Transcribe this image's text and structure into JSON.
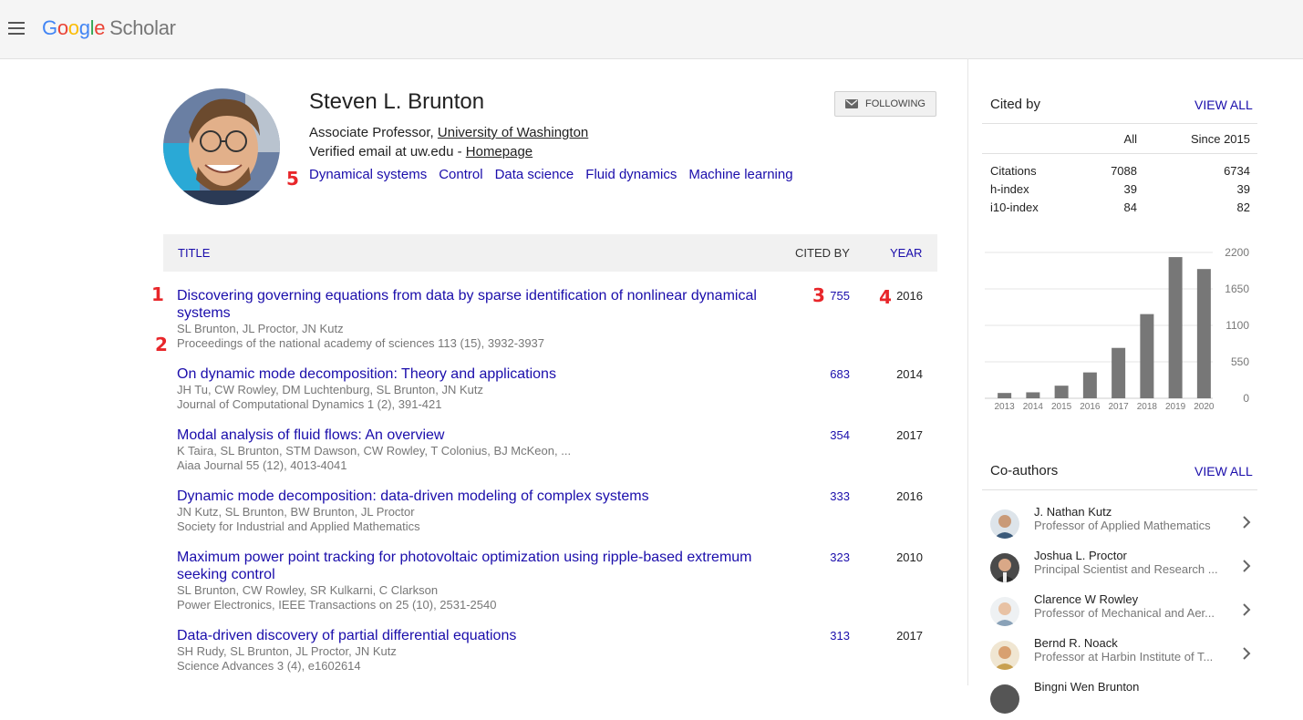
{
  "header": {
    "logo": {
      "google": [
        "G",
        "o",
        "o",
        "g",
        "l",
        "e"
      ],
      "scholar": "Scholar"
    }
  },
  "profile": {
    "name": "Steven L. Brunton",
    "title_prefix": "Associate Professor, ",
    "affiliation": "University of Washington",
    "email_prefix": "Verified email at uw.edu - ",
    "homepage": "Homepage",
    "interests": [
      "Dynamical systems",
      "Control",
      "Data science",
      "Fluid dynamics",
      "Machine learning"
    ],
    "follow_label": "FOLLOWING"
  },
  "annotations": [
    "1",
    "2",
    "3",
    "4",
    "5"
  ],
  "table": {
    "headers": {
      "title": "TITLE",
      "cited_by": "CITED BY",
      "year": "YEAR"
    },
    "rows": [
      {
        "title": "Discovering governing equations from data by sparse identification of nonlinear dynamical systems",
        "authors": "SL Brunton, JL Proctor, JN Kutz",
        "venue": "Proceedings of the national academy of sciences 113 (15), 3932-3937",
        "cited": "755",
        "year": "2016"
      },
      {
        "title": "On dynamic mode decomposition: Theory and applications",
        "authors": "JH Tu, CW Rowley, DM Luchtenburg, SL Brunton, JN Kutz",
        "venue": "Journal of Computational Dynamics 1 (2), 391-421",
        "cited": "683",
        "year": "2014"
      },
      {
        "title": "Modal analysis of fluid flows: An overview",
        "authors": "K Taira, SL Brunton, STM Dawson, CW Rowley, T Colonius, BJ McKeon, ...",
        "venue": "Aiaa Journal 55 (12), 4013-4041",
        "cited": "354",
        "year": "2017"
      },
      {
        "title": "Dynamic mode decomposition: data-driven modeling of complex systems",
        "authors": "JN Kutz, SL Brunton, BW Brunton, JL Proctor",
        "venue": "Society for Industrial and Applied Mathematics",
        "cited": "333",
        "year": "2016"
      },
      {
        "title": "Maximum power point tracking for photovoltaic optimization using ripple-based extremum seeking control",
        "authors": "SL Brunton, CW Rowley, SR Kulkarni, C Clarkson",
        "venue": "Power Electronics, IEEE Transactions on 25 (10), 2531-2540",
        "cited": "323",
        "year": "2010"
      },
      {
        "title": "Data-driven discovery of partial differential equations",
        "authors": "SH Rudy, SL Brunton, JL Proctor, JN Kutz",
        "venue": "Science Advances 3 (4), e1602614",
        "cited": "313",
        "year": "2017"
      }
    ]
  },
  "cited_by": {
    "heading": "Cited by",
    "view_all": "VIEW ALL",
    "col_all": "All",
    "col_since": "Since 2015",
    "stats": [
      {
        "label": "Citations",
        "all": "7088",
        "since": "6734"
      },
      {
        "label": "h-index",
        "all": "39",
        "since": "39"
      },
      {
        "label": "i10-index",
        "all": "84",
        "since": "82"
      }
    ]
  },
  "chart_data": {
    "type": "bar",
    "categories": [
      "2013",
      "2014",
      "2015",
      "2016",
      "2017",
      "2018",
      "2019",
      "2020"
    ],
    "values": [
      80,
      90,
      190,
      390,
      760,
      1270,
      2130,
      1950
    ],
    "ylim": [
      0,
      2200
    ],
    "yticks": [
      0,
      550,
      1100,
      1650,
      2200
    ],
    "grid": true,
    "bar_color": "#777777"
  },
  "coauthors": {
    "heading": "Co-authors",
    "view_all": "VIEW ALL",
    "items": [
      {
        "name": "J. Nathan Kutz",
        "affiliation": "Professor of Applied Mathematics"
      },
      {
        "name": "Joshua L. Proctor",
        "affiliation": "Principal Scientist and Research ..."
      },
      {
        "name": "Clarence W Rowley",
        "affiliation": "Professor of Mechanical and Aer..."
      },
      {
        "name": "Bernd R. Noack",
        "affiliation": "Professor at Harbin Institute of T..."
      },
      {
        "name": "Bingni Wen Brunton",
        "affiliation": ""
      }
    ]
  },
  "colors": {
    "link": "#1a0dab",
    "annotation": "#e8262a",
    "bar": "#777777"
  }
}
